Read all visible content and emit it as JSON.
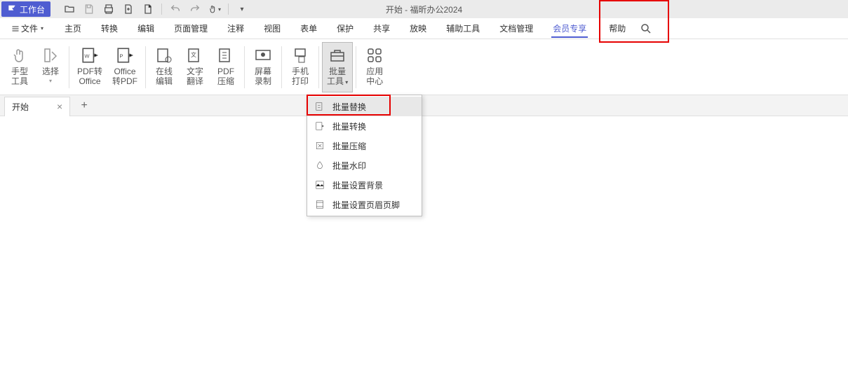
{
  "titleBar": {
    "workbench": "工作台",
    "title": "开始 - 福昕办公2024"
  },
  "menu": {
    "file": "文件",
    "items": [
      "主页",
      "转换",
      "编辑",
      "页面管理",
      "注释",
      "视图",
      "表单",
      "保护",
      "共享",
      "放映",
      "辅助工具",
      "文档管理",
      "会员专享"
    ],
    "help": "帮助"
  },
  "ribbon": {
    "handTool1": "手型",
    "handTool2": "工具",
    "select": "选择",
    "pdfToOffice1": "PDF转",
    "pdfToOffice2": "Office",
    "officeToPdf1": "Office",
    "officeToPdf2": "转PDF",
    "onlineEdit1": "在线",
    "onlineEdit2": "编辑",
    "textTrans1": "文字",
    "textTrans2": "翻译",
    "pdfCompress1": "PDF",
    "pdfCompress2": "压缩",
    "screenRec1": "屏幕",
    "screenRec2": "录制",
    "mobilePrint1": "手机",
    "mobilePrint2": "打印",
    "batchTool1": "批量",
    "batchTool2": "工具",
    "appCenter1": "应用",
    "appCenter2": "中心"
  },
  "tabs": {
    "start": "开始"
  },
  "dropdown": {
    "items": [
      "批量替换",
      "批量转换",
      "批量压缩",
      "批量水印",
      "批量设置背景",
      "批量设置页眉页脚"
    ]
  }
}
